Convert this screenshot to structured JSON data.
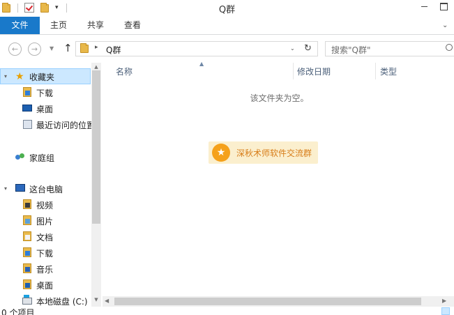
{
  "titlebar": {
    "title": "Q群"
  },
  "ribbon": {
    "tabs": [
      {
        "label": "文件",
        "active": true
      },
      {
        "label": "主页"
      },
      {
        "label": "共享"
      },
      {
        "label": "查看"
      }
    ]
  },
  "address": {
    "path": "Q群",
    "refresh_glyph": "↻"
  },
  "search": {
    "placeholder": "搜索\"Q群\""
  },
  "sidebar": {
    "favorites": {
      "label": "收藏夹",
      "items": [
        "下载",
        "桌面",
        "最近访问的位置"
      ]
    },
    "homegroup": {
      "label": "家庭组"
    },
    "thispc": {
      "label": "这台电脑",
      "items": [
        "视频",
        "图片",
        "文档",
        "下载",
        "音乐",
        "桌面"
      ],
      "drive": "本地磁盘 (C:)"
    }
  },
  "columns": {
    "name": "名称",
    "date": "修改日期",
    "type": "类型"
  },
  "content": {
    "empty_message": "该文件夹为空。"
  },
  "watermark": {
    "text": "深秋术师软件交流群"
  },
  "statusbar": {
    "text": "0 个项目"
  },
  "colors": {
    "accent": "#1979ca",
    "selection": "#cce8ff",
    "badge_bg": "#fbefce",
    "badge_fg": "#d77c17"
  }
}
